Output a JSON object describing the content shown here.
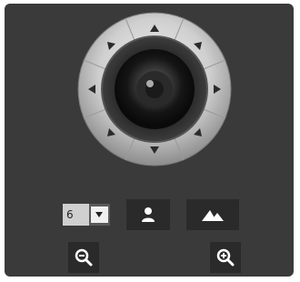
{
  "ptz": {
    "directions": [
      "up",
      "up-right",
      "right",
      "down-right",
      "down",
      "down-left",
      "left",
      "up-left"
    ]
  },
  "speed": {
    "value": "6"
  },
  "icons": {
    "person": "person-icon",
    "scene": "mountain-icon",
    "zoom_out": "zoom-out-icon",
    "zoom_in": "zoom-in-icon",
    "dropdown": "chevron-down-icon"
  },
  "colors": {
    "panel": "#3a3a3a",
    "button": "#2a2a2a",
    "ring": "#c8c8c8",
    "arrow": "#2b2b2b"
  }
}
